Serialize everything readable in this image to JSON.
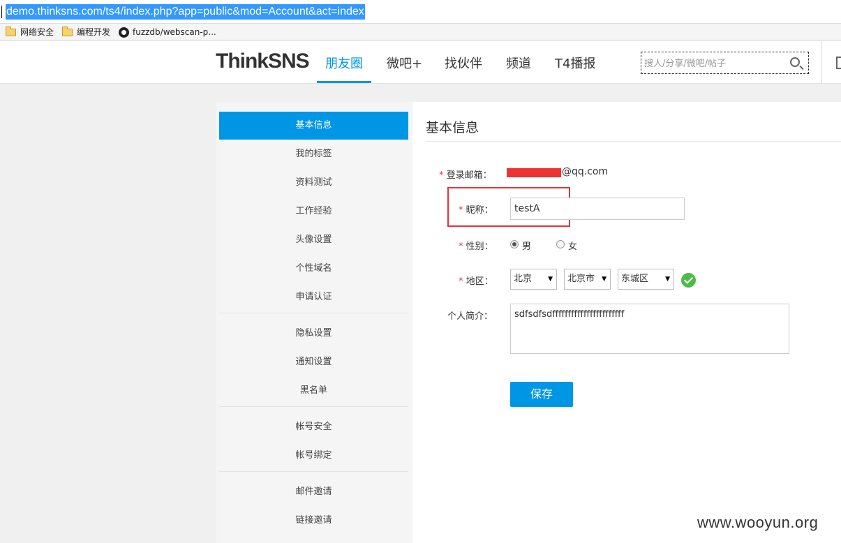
{
  "browser": {
    "url": "demo.thinksns.com/ts4/index.php?app=public&mod=Account&act=index",
    "bookmarks": [
      {
        "label": "网络安全",
        "icon": "folder-icon"
      },
      {
        "label": "编程开发",
        "icon": "folder-icon"
      },
      {
        "label": "fuzzdb/webscan-p...",
        "icon": "github-icon"
      }
    ]
  },
  "header": {
    "logo": "ThinkSNS",
    "nav": [
      "朋友圈",
      "微吧+",
      "找伙伴",
      "频道",
      "T4播报"
    ],
    "active_nav": "朋友圈",
    "search_placeholder": "搜人/分享/微吧/帖子"
  },
  "sidebar": {
    "items": [
      "基本信息",
      "我的标签",
      "资料测试",
      "工作经验",
      "头像设置",
      "个性域名",
      "申请认证",
      "隐私设置",
      "通知设置",
      "黑名单",
      "帐号安全",
      "帐号绑定",
      "邮件邀请",
      "链接邀请"
    ],
    "active": "基本信息"
  },
  "form": {
    "title": "基本信息",
    "required_mark": "*",
    "email_label": "登录邮箱：",
    "email_suffix": "@qq.com",
    "nickname_label": "昵称：",
    "nickname_value": "testA",
    "gender_label": "性别：",
    "gender_male": "男",
    "gender_female": "女",
    "gender_selected": "男",
    "region_label": "地区：",
    "province": "北京",
    "city": "北京市",
    "district": "东城区",
    "bio_label": "个人简介：",
    "bio_value": "sdfsdfsdfffffffffffffffffffffff",
    "save_label": "保存"
  },
  "watermark": "www.wooyun.org",
  "colors": {
    "accent": "#0096e6",
    "highlight": "#e53333",
    "success": "#4cbb49"
  }
}
